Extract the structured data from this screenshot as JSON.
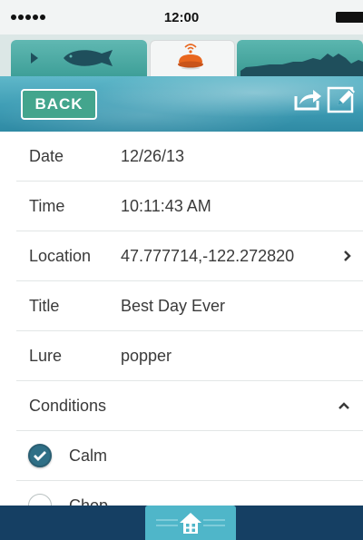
{
  "status_bar": {
    "time": "12:00"
  },
  "tabs": [
    {
      "name": "fish",
      "icon": "fish-icon"
    },
    {
      "name": "sonar",
      "icon": "sonar-device-icon",
      "active": true
    },
    {
      "name": "chart",
      "icon": "depth-chart-icon"
    }
  ],
  "header": {
    "back_label": "BACK",
    "share_icon": "share-icon",
    "edit_icon": "edit-icon"
  },
  "details": {
    "date": {
      "label": "Date",
      "value": "12/26/13"
    },
    "time": {
      "label": "Time",
      "value": "10:11:43 AM"
    },
    "location": {
      "label": "Location",
      "value": "47.777714,-122.272820"
    },
    "title": {
      "label": "Title",
      "value": "Best Day Ever"
    },
    "lure": {
      "label": "Lure",
      "value": "popper"
    }
  },
  "conditions": {
    "label": "Conditions",
    "options": [
      {
        "label": "Calm",
        "checked": true
      },
      {
        "label": "Chop",
        "checked": false
      }
    ]
  },
  "bottom_bar": {
    "home_icon": "home-icon"
  },
  "colors": {
    "header_water": "#3e9db5",
    "back_button": "#43a58d",
    "bottom_bar": "#153f63",
    "home_button": "#4fb6c9",
    "checkbox_checked": "#2f6f86",
    "sonar_orange": "#e8661e"
  }
}
